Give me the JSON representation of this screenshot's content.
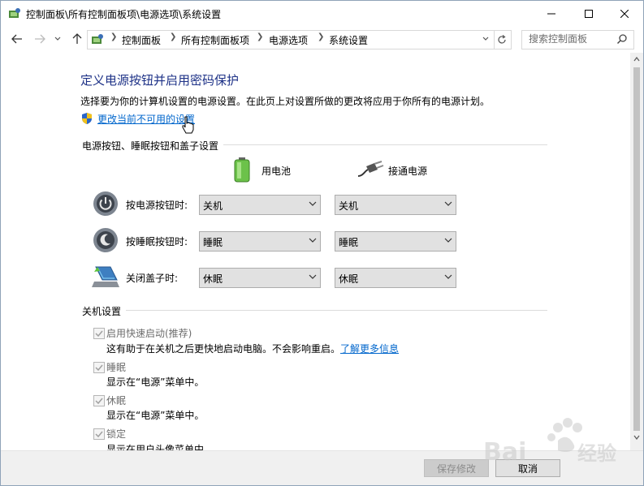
{
  "window": {
    "title": "控制面板\\所有控制面板项\\电源选项\\系统设置"
  },
  "address": {
    "breadcrumbs": [
      "控制面板",
      "所有控制面板项",
      "电源选项",
      "系统设置"
    ],
    "search_placeholder": "搜索控制面板"
  },
  "page": {
    "heading": "定义电源按钮并启用密码保护",
    "description": "选择要为你的计算机设置的电源设置。在此页上对设置所做的更改将应用于你所有的电源计划。",
    "change_link": "更改当前不可用的设置"
  },
  "power_buttons": {
    "section_title": "电源按钮、睡眠按钮和盖子设置",
    "col_battery": "用电池",
    "col_plugged": "接通电源",
    "rows": [
      {
        "label": "按电源按钮时:",
        "battery": "关机",
        "plugged": "关机"
      },
      {
        "label": "按睡眠按钮时:",
        "battery": "睡眠",
        "plugged": "睡眠"
      },
      {
        "label": "关闭盖子时:",
        "battery": "休眠",
        "plugged": "休眠"
      }
    ]
  },
  "shutdown": {
    "section_title": "关机设置",
    "items": [
      {
        "label": "启用快速启动(推荐)",
        "desc": "这有助于在关机之后更快地启动电脑。不会影响重启。",
        "link": "了解更多信息",
        "checked": true
      },
      {
        "label": "睡眠",
        "desc": "显示在“电源”菜单中。",
        "checked": true
      },
      {
        "label": "休眠",
        "desc": "显示在“电源”菜单中。",
        "checked": true
      },
      {
        "label": "锁定",
        "desc": "显示在用户头像菜单中。",
        "checked": true
      }
    ]
  },
  "footer": {
    "save": "保存修改",
    "cancel": "取消"
  },
  "colors": {
    "heading": "#1e3287",
    "link": "#0066cc",
    "disabled_text": "#6d6d6d"
  }
}
